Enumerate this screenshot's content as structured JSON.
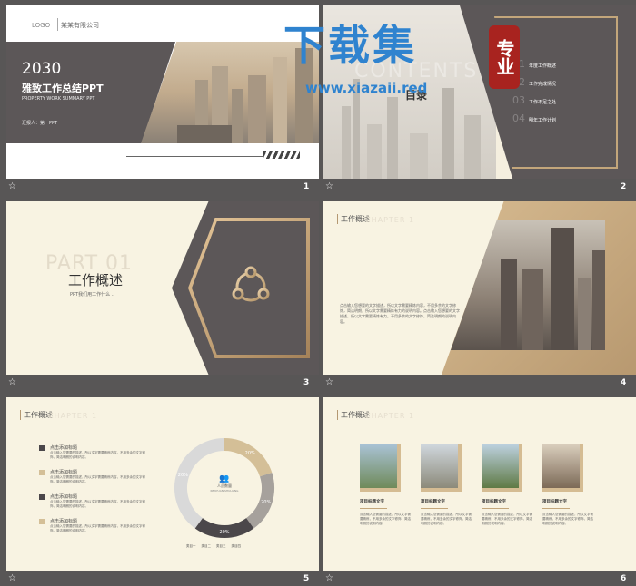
{
  "watermark": {
    "title": "下载集",
    "url": "www.xiazaii.red",
    "seal": "专业"
  },
  "s1": {
    "logo": "LOGO",
    "company": "某某有限公司",
    "year": "2030",
    "title": "雅致工作总结PPT",
    "subtitle": "PROPERTY WORK SUMMARY PPT",
    "reporter": "汇报人：第一PPT",
    "num": "1"
  },
  "s2": {
    "contents_bg": "CONTENTS",
    "title": "目录",
    "items": [
      {
        "n": "01",
        "t": "年度工作概述"
      },
      {
        "n": "02",
        "t": "工作完成情况"
      },
      {
        "n": "03",
        "t": "工作不足之处"
      },
      {
        "n": "04",
        "t": "明年工作计划"
      }
    ],
    "num": "2"
  },
  "s3": {
    "part": "PART 01",
    "title": "工作概述",
    "subtitle": "PPT我们用工作什么 ..",
    "num": "3"
  },
  "s4": {
    "heading": "工作概述",
    "chapter": "CHAPTER 1",
    "paragraph": "点击输入您想要的文字描述，所以文字需要精炼内容，不用多余的文字修饰，简洁明朗，所以文字需要精炼有力的说明内容。点击输入您想要的文字描述，所以文字需要精炼有力。不用多余的文字修饰，简洁明朗的说明内容。",
    "num": "4"
  },
  "s5": {
    "heading": "工作概述",
    "chapter": "CHAPTER 1",
    "items": [
      {
        "title": "点击添加标题",
        "text": "点击输入您需要的描述，所以文字需要精炼内容，不用多余的文字修饰，简洁明朗的说明内容。"
      },
      {
        "title": "点击添加标题",
        "text": "点击输入您需要的描述，所以文字需要精炼内容，不用多余的文字修饰，简洁明朗的说明内容。"
      },
      {
        "title": "点击添加标题",
        "text": "点击输入您需要的描述，所以文字需要精炼内容，不用多余的文字修饰，简洁明朗的说明内容。"
      },
      {
        "title": "点击添加标题",
        "text": "点击输入您需要的描述，所以文字需要精炼内容，不用多余的文字修饰，简洁明朗的说明内容。"
      }
    ],
    "center_title": "人员数量",
    "center_sub": "RENYUAN SHULIANG",
    "legend": [
      "类目一",
      "类目二",
      "类目三",
      "类目四"
    ],
    "ring": [
      {
        "label": "20%",
        "value": 20,
        "color": "#d4bf97"
      },
      {
        "label": "20%",
        "value": 20,
        "color": "#a6a19c"
      },
      {
        "label": "20%",
        "value": 20,
        "color": "#4b474a"
      },
      {
        "label": "20%",
        "value": 40,
        "color": "#d9d9d9"
      }
    ],
    "num": "5"
  },
  "s6": {
    "heading": "工作概述",
    "chapter": "CHAPTER 1",
    "cards": [
      {
        "title": "项目标题文字",
        "text": "点击输入您需要的描述，所以文字需要精炼，不用多余的文字修饰，简洁明朗的说明内容。"
      },
      {
        "title": "项目标题文字",
        "text": "点击输入您需要的描述，所以文字需要精炼，不用多余的文字修饰，简洁明朗的说明内容。"
      },
      {
        "title": "项目标题文字",
        "text": "点击输入您需要的描述，所以文字需要精炼，不用多余的文字修饰，简洁明朗的说明内容。"
      },
      {
        "title": "项目标题文字",
        "text": "点击输入您需要的描述，所以文字需要精炼，不用多余的文字修饰，简洁明朗的说明内容。"
      }
    ],
    "num": "6"
  },
  "colors": {
    "dark": "#5c5758",
    "gold": "#c3a67b",
    "cream": "#f8f3e2",
    "bg": "#585656"
  }
}
